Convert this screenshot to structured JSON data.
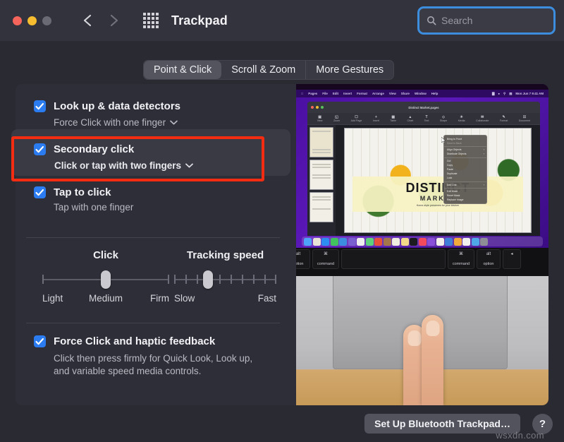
{
  "window": {
    "title": "Trackpad",
    "traffic_lights": [
      "close",
      "minimize",
      "zoom"
    ],
    "nav": {
      "back": "back-chevron",
      "forward": "forward-chevron",
      "grid": "show-all-icon"
    }
  },
  "search": {
    "placeholder": "Search",
    "value": "",
    "icon": "search-icon",
    "focused": true
  },
  "tabs": [
    {
      "label": "Point & Click",
      "active": true
    },
    {
      "label": "Scroll & Zoom",
      "active": false
    },
    {
      "label": "More Gestures",
      "active": false
    }
  ],
  "options": [
    {
      "title": "Look up & data detectors",
      "subtitle": "Force Click with one finger",
      "checked": true,
      "has_popup": true,
      "highlighted": false
    },
    {
      "title": "Secondary click",
      "subtitle": "Click or tap with two fingers",
      "checked": true,
      "has_popup": true,
      "highlighted": true
    },
    {
      "title": "Tap to click",
      "subtitle": "Tap with one finger",
      "checked": true,
      "has_popup": false,
      "highlighted": false
    }
  ],
  "sliders": [
    {
      "title": "Click",
      "labels": [
        "Light",
        "Medium",
        "Firm"
      ],
      "ticks": 3,
      "value_index": 1
    },
    {
      "title": "Tracking speed",
      "labels": [
        "Slow",
        "Fast"
      ],
      "ticks": 10,
      "value_index": 3
    }
  ],
  "force_click": {
    "title": "Force Click and haptic feedback",
    "checked": true,
    "description_line1": "Click then press firmly for Quick Look, Look up,",
    "description_line2": "and variable speed media controls."
  },
  "annotation": {
    "color": "#f32c12",
    "target": "Secondary click"
  },
  "footer": {
    "bluetooth_button": "Set Up Bluetooth Trackpad…",
    "help_button": "?"
  },
  "watermark": "wsxdn.com",
  "preview": {
    "description": "Demo video: two fingers tapping a trackpad to open a contextual menu",
    "menubar": {
      "apple": "",
      "items": [
        "Pages",
        "File",
        "Edit",
        "Insert",
        "Format",
        "Arrange",
        "View",
        "Share",
        "Window",
        "Help"
      ],
      "clock": "Mon Jun 7  9:41 AM"
    },
    "document": {
      "name": "Distinct Market.pages",
      "title": "DISTINCT",
      "subtitle": "MARKET",
      "tagline": "Home-style preserves for your kitchen"
    },
    "toolbar_items": [
      "View",
      "Zoom",
      "Add Page",
      "Insert",
      "Table",
      "Chart",
      "Text",
      "Shape",
      "Media",
      "Comment",
      "Collaborate",
      "Format",
      "Document"
    ],
    "context_menu": [
      "Bring to Front",
      "Send to Back",
      "Align Objects",
      "Distribute Objects",
      "Cut",
      "Copy",
      "Paste",
      "Duplicate",
      "Lock",
      "Add Link",
      "Edit Mask",
      "Reset Mask",
      "Replace Image"
    ],
    "keys": [
      "alt option",
      "command",
      "space",
      "command",
      "alt option",
      "eject"
    ]
  }
}
